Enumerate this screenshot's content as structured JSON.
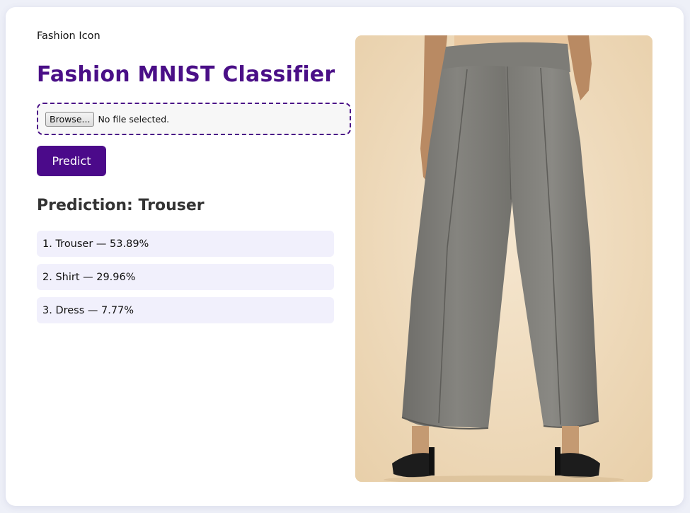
{
  "header": {
    "logo_text": "Fashion Icon",
    "title": "Fashion MNIST Classifier"
  },
  "upload": {
    "browse_label": "Browse...",
    "file_status": "No file selected."
  },
  "actions": {
    "predict_label": "Predict"
  },
  "prediction": {
    "heading": "Prediction: Trouser",
    "results": [
      "1. Trouser — 53.89%",
      "2. Shirt — 29.96%",
      "3. Dress — 7.77%"
    ]
  },
  "image": {
    "subject": "grey wide-leg trousers product photo"
  },
  "colors": {
    "accent": "#4b0a8a",
    "title": "#4a0f87",
    "result_bg": "#f1f0fc",
    "photo_bg": "#efdcc0"
  }
}
